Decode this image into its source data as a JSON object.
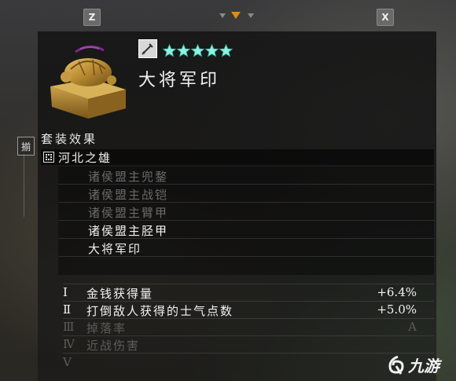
{
  "topbar": {
    "left_key": "Z",
    "right_key": "X"
  },
  "item": {
    "name": "大将军印",
    "stars": 5,
    "icon": "sword-icon",
    "image": "bronze-turtle-seal",
    "accent": "#e08a1c"
  },
  "side_tab": {
    "label": "揃"
  },
  "set": {
    "section_title": "套装效果",
    "name": "河北之雄",
    "pieces": [
      {
        "label": "诸侯盟主兜鍪",
        "active": false
      },
      {
        "label": "诸侯盟主战铠",
        "active": false
      },
      {
        "label": "诸侯盟主臂甲",
        "active": false
      },
      {
        "label": "诸侯盟主胫甲",
        "active": true
      },
      {
        "label": "大将军印",
        "active": true
      }
    ]
  },
  "stats": [
    {
      "num": "Ⅰ",
      "label": "金钱获得量",
      "value": "+6.4%",
      "active": true
    },
    {
      "num": "Ⅱ",
      "label": "打倒敌人获得的士气点数",
      "value": "+5.0%",
      "active": true
    },
    {
      "num": "Ⅲ",
      "label": "掉落率",
      "value": "A",
      "active": false
    },
    {
      "num": "Ⅳ",
      "label": "近战伤害",
      "value": "",
      "active": false
    },
    {
      "num": "Ⅴ",
      "label": "",
      "value": "",
      "active": false
    }
  ],
  "watermark": {
    "text": "九游"
  }
}
